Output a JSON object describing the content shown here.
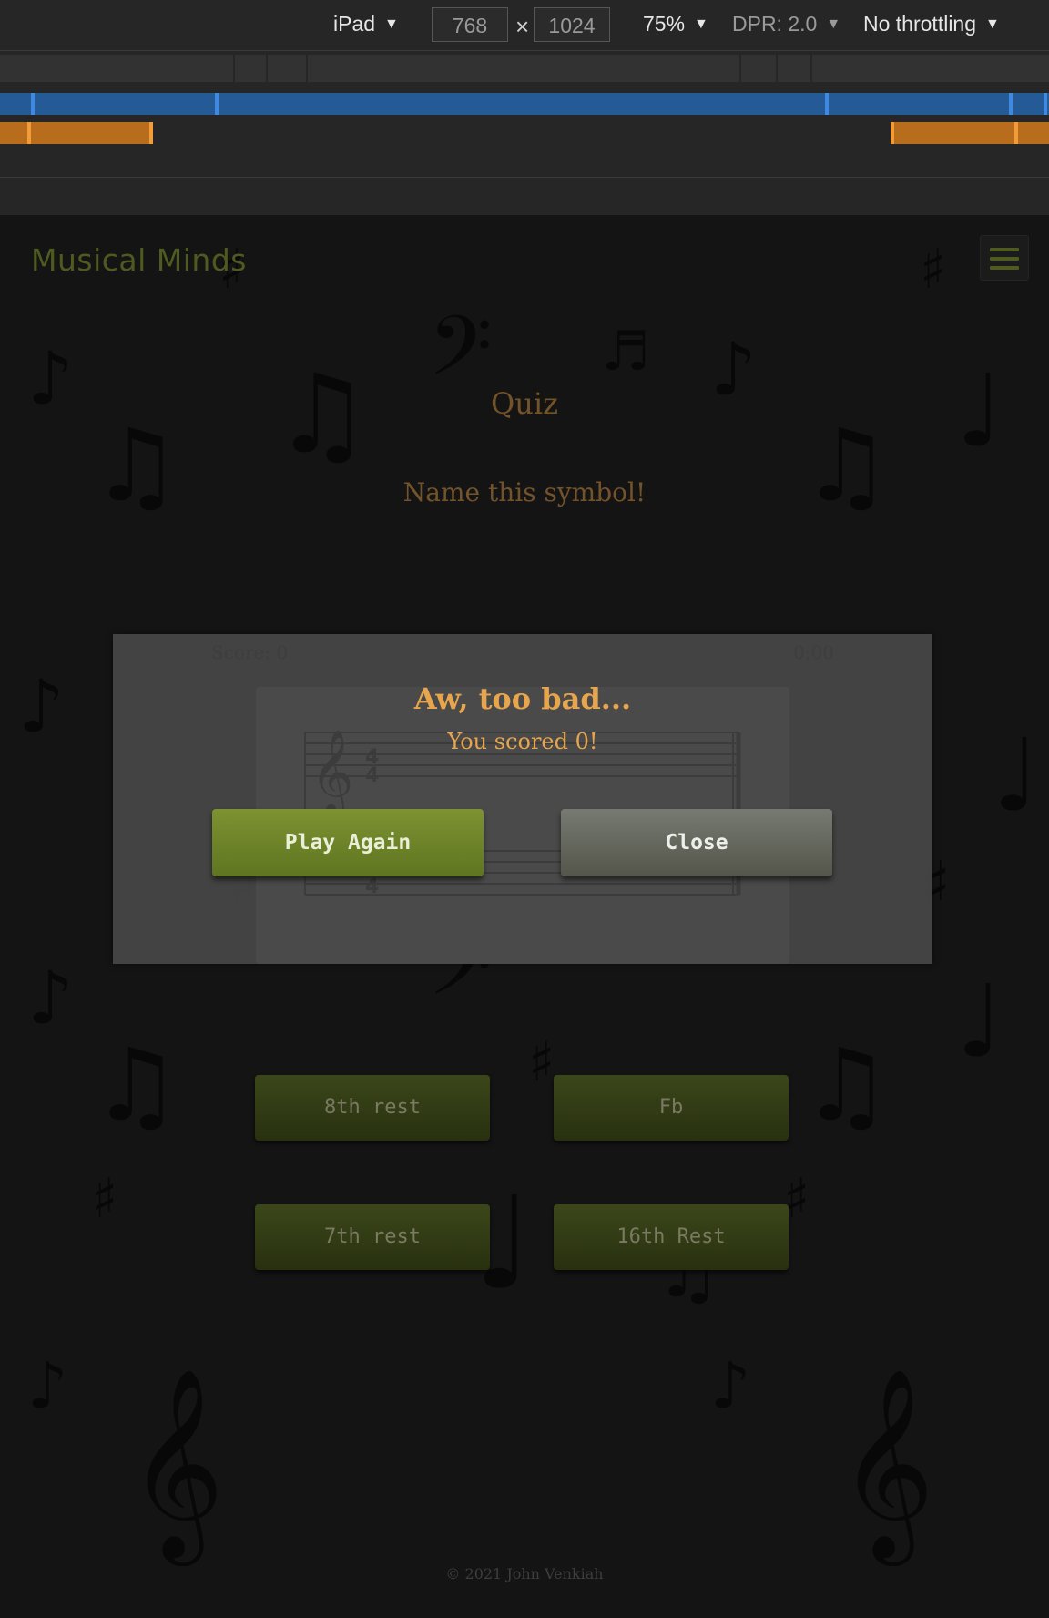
{
  "devtools": {
    "device": "iPad",
    "width": "768",
    "height": "1024",
    "times": "×",
    "zoom": "75%",
    "dpr": "DPR: 2.0",
    "throttling": "No throttling"
  },
  "header": {
    "brand": "Musical Minds",
    "menu_icon": "hamburger-icon"
  },
  "main": {
    "title": "Quiz",
    "prompt": "Name this symbol!",
    "answers": [
      {
        "label": "8th rest"
      },
      {
        "label": "Fb"
      },
      {
        "label": "7th rest"
      },
      {
        "label": "16th Rest"
      }
    ]
  },
  "modal": {
    "score_label": "Score: 0",
    "timer": "0:00",
    "title": "Aw, too bad...",
    "subtitle": "You scored 0!",
    "play_again": "Play Again",
    "close": "Close"
  },
  "footer": {
    "copyright": "© 2021 John Venkiah"
  },
  "colors": {
    "brand": "#4f5a20",
    "accent": "#e7a54d",
    "play_again": "#7d9231",
    "close": "#6a6c62"
  }
}
